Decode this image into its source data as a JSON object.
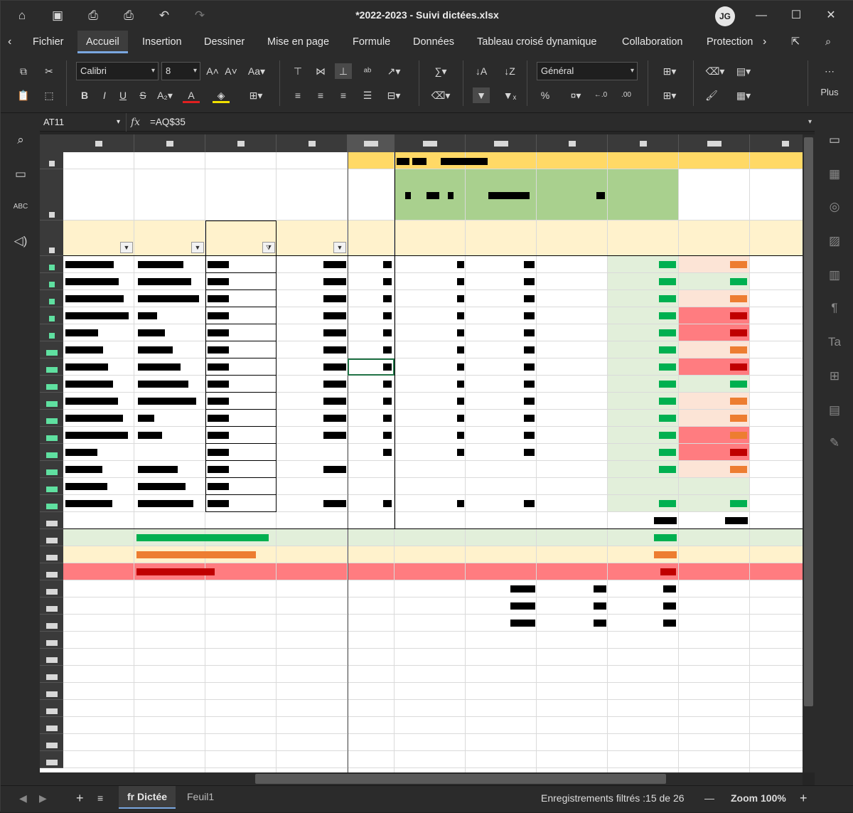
{
  "app": {
    "title": "*2022-2023 - Suivi dictées.xlsx",
    "user_initials": "JG"
  },
  "titlebar_icons": [
    "home-icon",
    "save-icon",
    "print-icon",
    "print-preview-icon",
    "undo-icon",
    "redo-icon"
  ],
  "menu": {
    "items": [
      "Fichier",
      "Accueil",
      "Insertion",
      "Dessiner",
      "Mise en page",
      "Formule",
      "Données",
      "Tableau croisé dynamique",
      "Collaboration",
      "Protection"
    ],
    "active": "Accueil"
  },
  "ribbon": {
    "font_name": "Calibri",
    "font_size": "8",
    "number_format": "Général",
    "more_label": "Plus"
  },
  "formula_bar": {
    "cell_ref": "AT11",
    "fx": "fx",
    "formula": "=AQ$35"
  },
  "status": {
    "sheet_tabs": [
      "fr Dictée",
      "Feuil1"
    ],
    "active_sheet": "fr Dictée",
    "filter_info": "Enregistrements filtrés :15 de 26",
    "zoom": "Zoom 100%"
  },
  "colors": {
    "accent": "#7aa7e0",
    "yellow_header": "#ffd966",
    "green_header": "#a9d08e",
    "cream": "#fff2cc",
    "light_green": "#e2efda",
    "red": "#ff7c80",
    "peach": "#fce4d6",
    "green_text": "#00b050",
    "orange_text": "#ed7d31",
    "red_text": "#c00000"
  }
}
